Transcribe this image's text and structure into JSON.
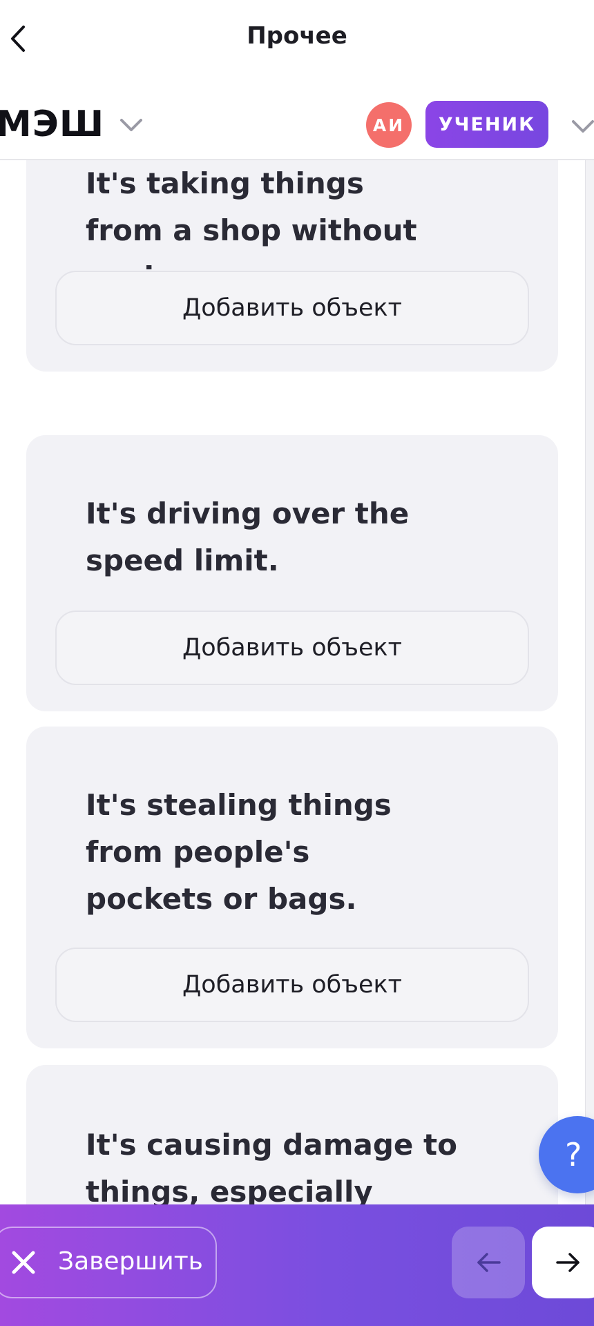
{
  "topbar": {
    "title": "Прочее",
    "back_icon": "chevron-left-icon"
  },
  "header": {
    "logo": "МЭШ",
    "logo_dropdown_icon": "chevron-down-icon",
    "avatar_initials": "АИ",
    "role_label": "УЧЕНИК",
    "role_dropdown_icon": "chevron-down-icon"
  },
  "cards": [
    {
      "text": "It's taking things from a shop without paying.",
      "button_label": "Добавить объект"
    },
    {
      "text": "It's driving over the speed limit.",
      "button_label": "Добавить объект"
    },
    {
      "text": "It's stealing things from people's pockets or bags.",
      "button_label": "Добавить объект"
    },
    {
      "text": "It's causing damage to things, especially public"
    }
  ],
  "help": {
    "label": "?"
  },
  "footer": {
    "finish_label": "Завершить",
    "finish_icon": "close-icon",
    "prev_icon": "arrow-left-icon",
    "next_icon": "arrow-right-icon"
  },
  "colors": {
    "accent_purple": "#8b45e6",
    "avatar_red": "#f46f6b",
    "help_blue": "#4b73f0",
    "card_bg": "#f2f2f6"
  }
}
